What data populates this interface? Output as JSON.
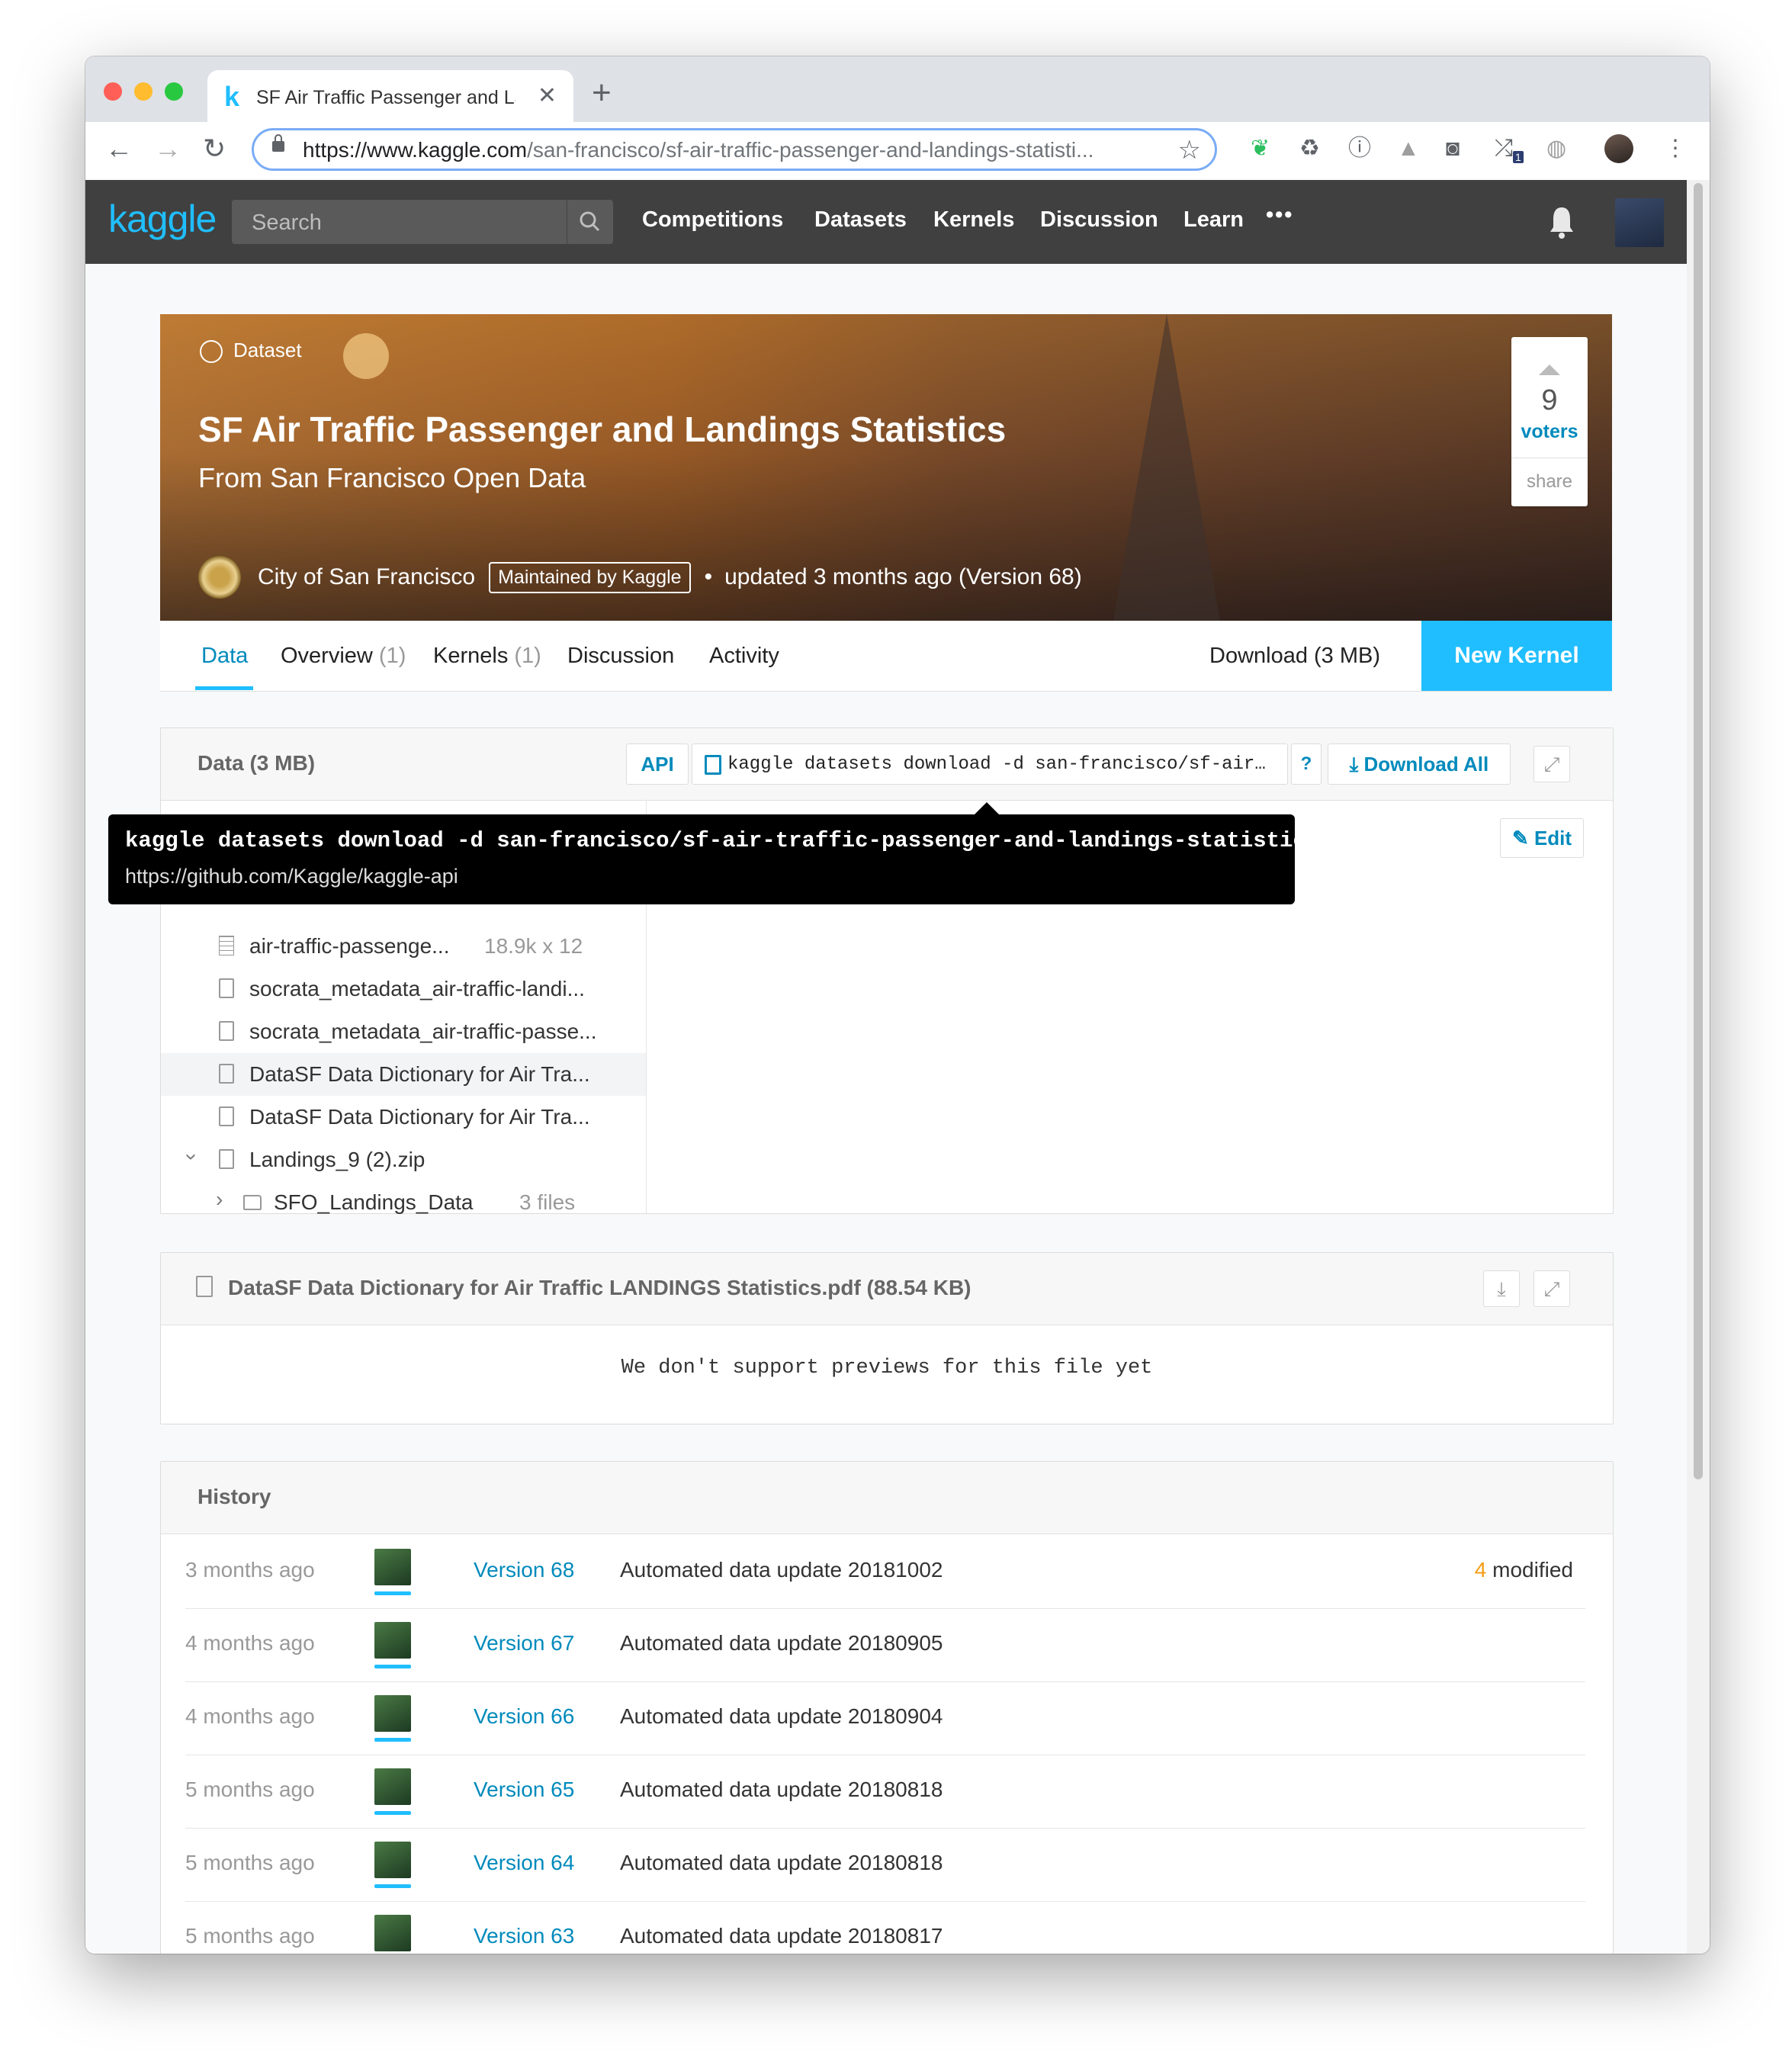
{
  "browser": {
    "tab_title": "SF Air Traffic Passenger and La",
    "url_host": "https://www.kaggle.com",
    "url_path": "/san-francisco/sf-air-traffic-passenger-and-landings-statisti...",
    "extension_badge": "1"
  },
  "navbar": {
    "logo": "kaggle",
    "search_placeholder": "Search",
    "links": [
      "Competitions",
      "Datasets",
      "Kernels",
      "Discussion",
      "Learn"
    ],
    "more": "•••"
  },
  "hero": {
    "type_label": "Dataset",
    "title": "SF Air Traffic Passenger and Landings Statistics",
    "subtitle": "From San Francisco Open Data",
    "owner": "City of San Francisco",
    "maintained_badge": "Maintained by Kaggle",
    "updated": "updated 3 months ago (Version 68)",
    "votes": "9",
    "votes_label": "voters",
    "share_label": "share"
  },
  "tabs": {
    "items": [
      {
        "label": "Data",
        "count": ""
      },
      {
        "label": "Overview",
        "count": "(1)"
      },
      {
        "label": "Kernels",
        "count": "(1)"
      },
      {
        "label": "Discussion",
        "count": ""
      },
      {
        "label": "Activity",
        "count": ""
      }
    ],
    "download": "Download (3 MB)",
    "new_kernel": "New Kernel"
  },
  "data_panel": {
    "title": "Data (3 MB)",
    "api_label": "API",
    "command_truncated": "kaggle datasets download -d san-francisco/sf-air…",
    "help": "?",
    "download_all": "Download All",
    "edit": "Edit",
    "files": [
      {
        "name": "air-traffic-passenge...",
        "meta": "18.9k x 12",
        "icon": "table-icon"
      },
      {
        "name": "socrata_metadata_air-traffic-landi...",
        "meta": "",
        "icon": "file-text-icon"
      },
      {
        "name": "socrata_metadata_air-traffic-passe...",
        "meta": "",
        "icon": "file-text-icon"
      },
      {
        "name": "DataSF Data Dictionary for Air Tra...",
        "meta": "",
        "icon": "file-icon"
      },
      {
        "name": "DataSF Data Dictionary for Air Tra...",
        "meta": "",
        "icon": "file-icon"
      },
      {
        "name": "Landings_9 (2).zip",
        "meta": "",
        "icon": "zip-icon"
      },
      {
        "name": "SFO_Landings_Data",
        "meta": "3 files",
        "icon": "folder-icon"
      }
    ]
  },
  "tooltip": {
    "command": "kaggle datasets download -d san-francisco/sf-air-traffic-passenger-and-landings-statistics",
    "url": "https://github.com/Kaggle/kaggle-api"
  },
  "preview_panel": {
    "title": "DataSF Data Dictionary for Air Traffic LANDINGS Statistics.pdf (88.54 KB)",
    "message": "We don't support previews for this file yet"
  },
  "history": {
    "title": "History",
    "rows": [
      {
        "time": "3 months ago",
        "version": "Version 68",
        "message": "Automated data update 20181002",
        "modified_count": "4",
        "modified_label": "modified"
      },
      {
        "time": "4 months ago",
        "version": "Version 67",
        "message": "Automated data update 20180905",
        "modified_count": "",
        "modified_label": ""
      },
      {
        "time": "4 months ago",
        "version": "Version 66",
        "message": "Automated data update 20180904",
        "modified_count": "",
        "modified_label": ""
      },
      {
        "time": "5 months ago",
        "version": "Version 65",
        "message": "Automated data update 20180818",
        "modified_count": "",
        "modified_label": ""
      },
      {
        "time": "5 months ago",
        "version": "Version 64",
        "message": "Automated data update 20180818",
        "modified_count": "",
        "modified_label": ""
      },
      {
        "time": "5 months ago",
        "version": "Version 63",
        "message": "Automated data update 20180817",
        "modified_count": "",
        "modified_label": ""
      }
    ]
  },
  "colors": {
    "kaggle_blue": "#20beff",
    "link_blue": "#008abc",
    "navbar_bg": "#404040",
    "modified_orange": "#f39c12"
  }
}
